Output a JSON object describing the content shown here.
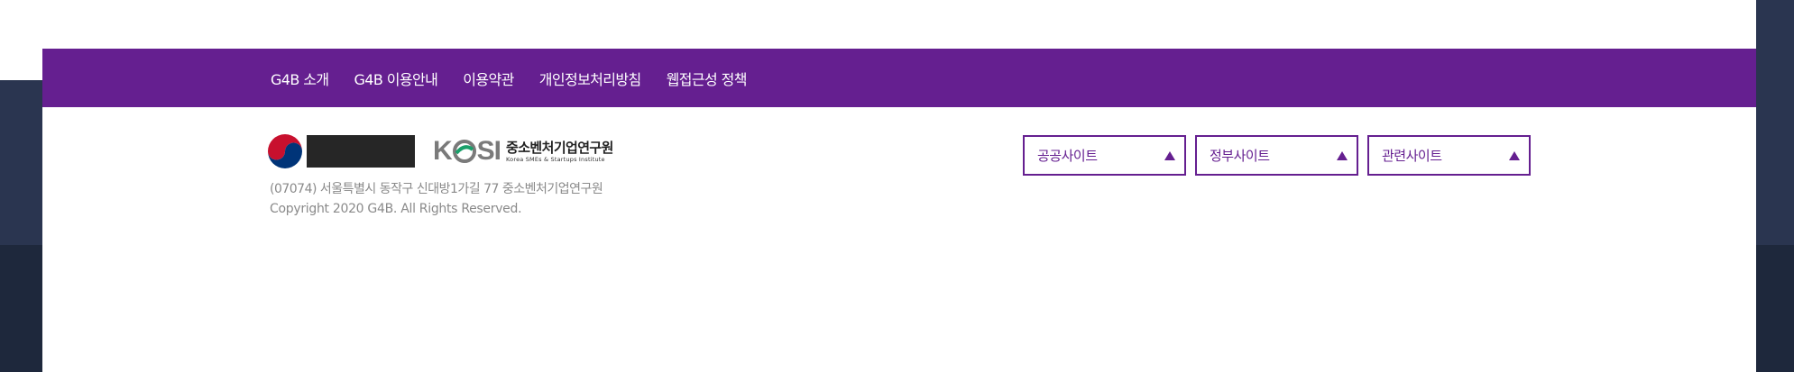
{
  "nav": {
    "links": [
      "G4B 소개",
      "G4B 이용안내",
      "이용약관",
      "개인정보처리방침",
      "웹접근성 정책"
    ]
  },
  "logos": {
    "kosi_mark": "KOSI",
    "kosi_name_kr": "중소벤처기업연구원",
    "kosi_name_en": "Korea SMEs & Startups Institute"
  },
  "footer_info": {
    "address": "(07074) 서울특별시 동작구 신대방1가길 77 중소벤처기업연구원",
    "copyright": "Copyright 2020 G4B. All Rights Reserved."
  },
  "site_selects": [
    {
      "label": "공공사이트"
    },
    {
      "label": "정부사이트"
    },
    {
      "label": "관련사이트"
    }
  ],
  "colors": {
    "brand_purple": "#651f90",
    "dark_bg": "#2a3550",
    "text_gray": "#8a8a8a"
  }
}
